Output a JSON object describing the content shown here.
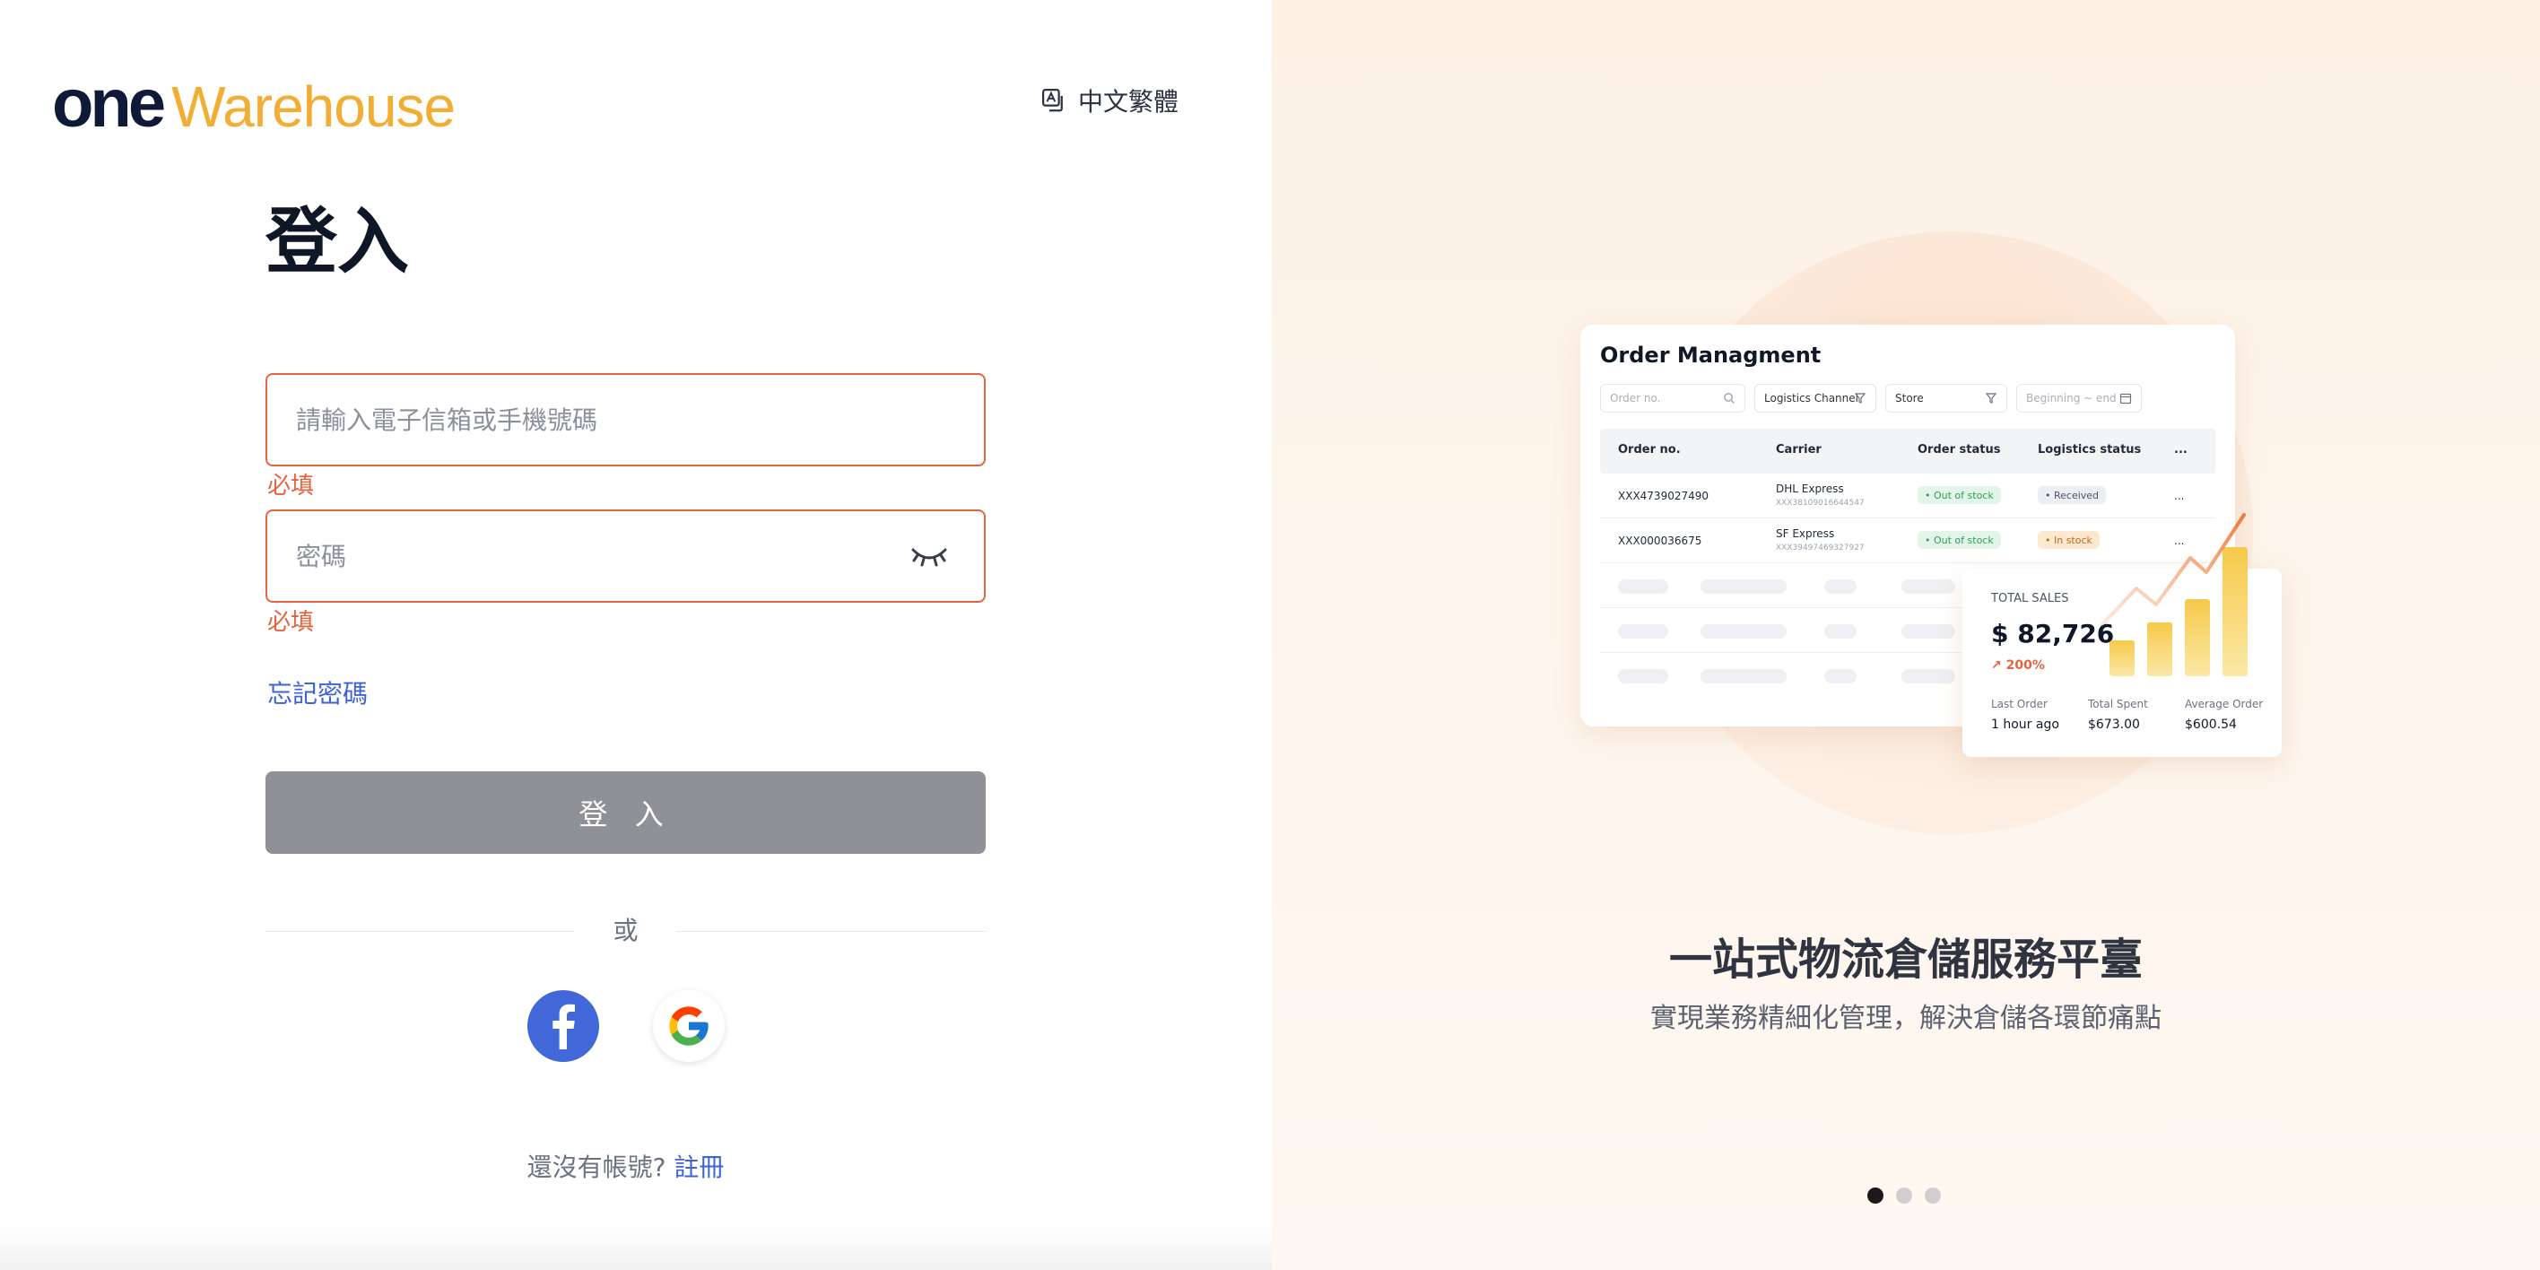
{
  "brand": {
    "one": "one",
    "warehouse": "Warehouse",
    "accent": "#f2ad32",
    "dark": "#0e1a38"
  },
  "language": {
    "label": "中文繁體",
    "icon": "translate-icon"
  },
  "login": {
    "title": "登入",
    "email_placeholder": "請輸入電子信箱或手機號碼",
    "email_error": "必填",
    "password_placeholder": "密碼",
    "password_error": "必填",
    "forgot": "忘記密碼",
    "submit": "登 入",
    "or": "或",
    "signup_prompt": "還沒有帳號?",
    "signup_link": "註冊",
    "error_color": "#e5633f",
    "link_color": "#3e63d6"
  },
  "social": {
    "facebook_icon": "facebook-icon",
    "google_icon": "google-icon"
  },
  "promo": {
    "card_title": "Order Managment",
    "filters": [
      {
        "label": "Order no."
      },
      {
        "label": "Logistics Channel"
      },
      {
        "label": "Store"
      },
      {
        "label": "Beginning ~ end"
      }
    ],
    "columns": [
      "Order no.",
      "Carrier",
      "Order status",
      "Logistics status",
      "..."
    ],
    "rows": [
      {
        "order": "XXX4739027490",
        "carrier": "DHL Express",
        "tracking": "XXX38109016644547",
        "status": "• Out of stock",
        "logistics": "• Received",
        "more": "..."
      },
      {
        "order": "XXX000036675",
        "carrier": "SF Express",
        "tracking": "XXX39497469327927",
        "status": "• Out of stock",
        "logistics": "• In stock",
        "more": "..."
      }
    ],
    "sales": {
      "label": "TOTAL SALES",
      "value": "$ 82,726",
      "change": "↗ 200%",
      "stats": [
        {
          "k": "Last Order",
          "v": "1 hour ago"
        },
        {
          "k": "Total Spent",
          "v": "$673.00"
        },
        {
          "k": "Average Order",
          "v": "$600.54"
        }
      ]
    },
    "headline": "一站式物流倉儲服務平臺",
    "subline": "實現業務精細化管理，解決倉儲各環節痛點",
    "slides": [
      1,
      2,
      3
    ],
    "active_slide": 0
  }
}
